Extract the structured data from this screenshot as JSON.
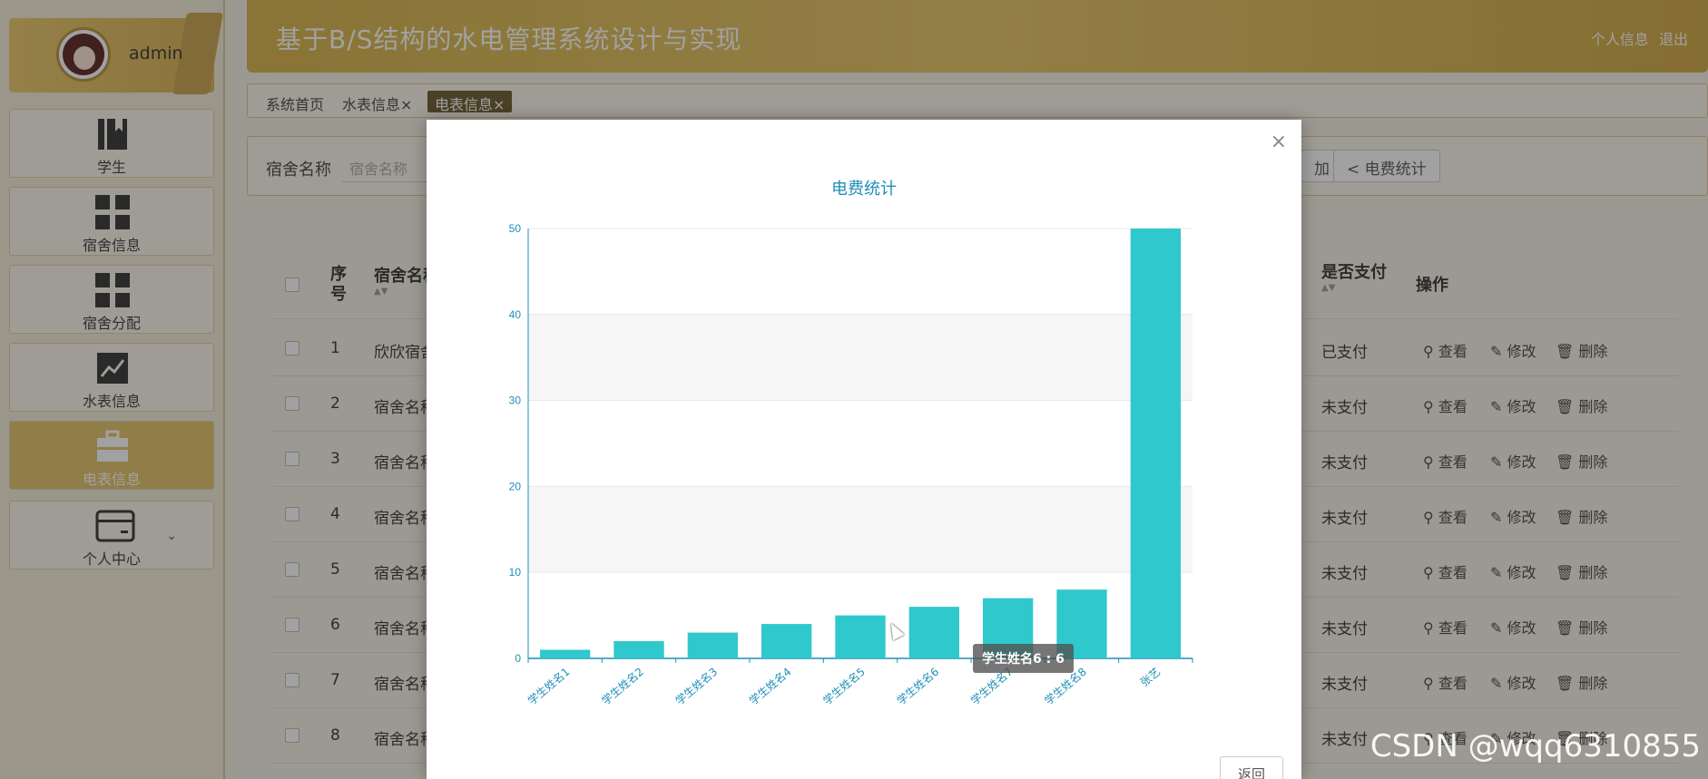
{
  "sidebar": {
    "user": "admin",
    "items": [
      {
        "label": "学生",
        "icon": "book-icon"
      },
      {
        "label": "宿舍信息",
        "icon": "grid-icon"
      },
      {
        "label": "宿舍分配",
        "icon": "grid-icon"
      },
      {
        "label": "水表信息",
        "icon": "trend-chart-icon"
      },
      {
        "label": "电表信息",
        "icon": "briefcase-icon"
      },
      {
        "label": "个人中心",
        "icon": "card-icon"
      }
    ]
  },
  "header": {
    "title": "基于B/S结构的水电管理系统设计与实现",
    "profile_link": "个人信息",
    "logout_link": "退出"
  },
  "tabs": [
    {
      "label": "系统首页"
    },
    {
      "label": "水表信息×"
    },
    {
      "label": "电表信息×"
    }
  ],
  "filter": {
    "label": "宿舍名称",
    "placeholder": "宿舍名称",
    "partial_button": "加",
    "stats_button": "电费统计"
  },
  "table": {
    "headers": {
      "seq": "序号",
      "dorm": "宿舍名称",
      "paid": "是否支付",
      "ops": "操作"
    },
    "rows": [
      {
        "seq": "1",
        "dorm": "欣欣宿舍",
        "paid": "已支付"
      },
      {
        "seq": "2",
        "dorm": "宿舍名称",
        "paid": "未支付"
      },
      {
        "seq": "3",
        "dorm": "宿舍名称",
        "paid": "未支付"
      },
      {
        "seq": "4",
        "dorm": "宿舍名称",
        "paid": "未支付"
      },
      {
        "seq": "5",
        "dorm": "宿舍名称",
        "paid": "未支付"
      },
      {
        "seq": "6",
        "dorm": "宿舍名称",
        "paid": "未支付"
      },
      {
        "seq": "7",
        "dorm": "宿舍名称",
        "paid": "未支付"
      },
      {
        "seq": "8",
        "dorm": "宿舍名称",
        "paid": "未支付"
      }
    ],
    "actions": {
      "view": "查看",
      "edit": "修改",
      "delete": "删除"
    }
  },
  "modal": {
    "close": "×",
    "return_button": "返回",
    "tooltip": "学生姓名6 : 6"
  },
  "chart_data": {
    "type": "bar",
    "title": "电费统计",
    "categories": [
      "学生姓名1",
      "学生姓名2",
      "学生姓名3",
      "学生姓名4",
      "学生姓名5",
      "学生姓名6",
      "学生姓名7",
      "学生姓名8",
      "张艺"
    ],
    "values": [
      1,
      2,
      3,
      4,
      5,
      6,
      7,
      8,
      50
    ],
    "ylim": [
      0,
      50
    ],
    "yticks": [
      0,
      10,
      20,
      30,
      40,
      50
    ],
    "bar_color": "#2fc8cc",
    "axis_color": "#1e8fb8",
    "grid": true
  },
  "watermark": "CSDN @wqq6310855"
}
